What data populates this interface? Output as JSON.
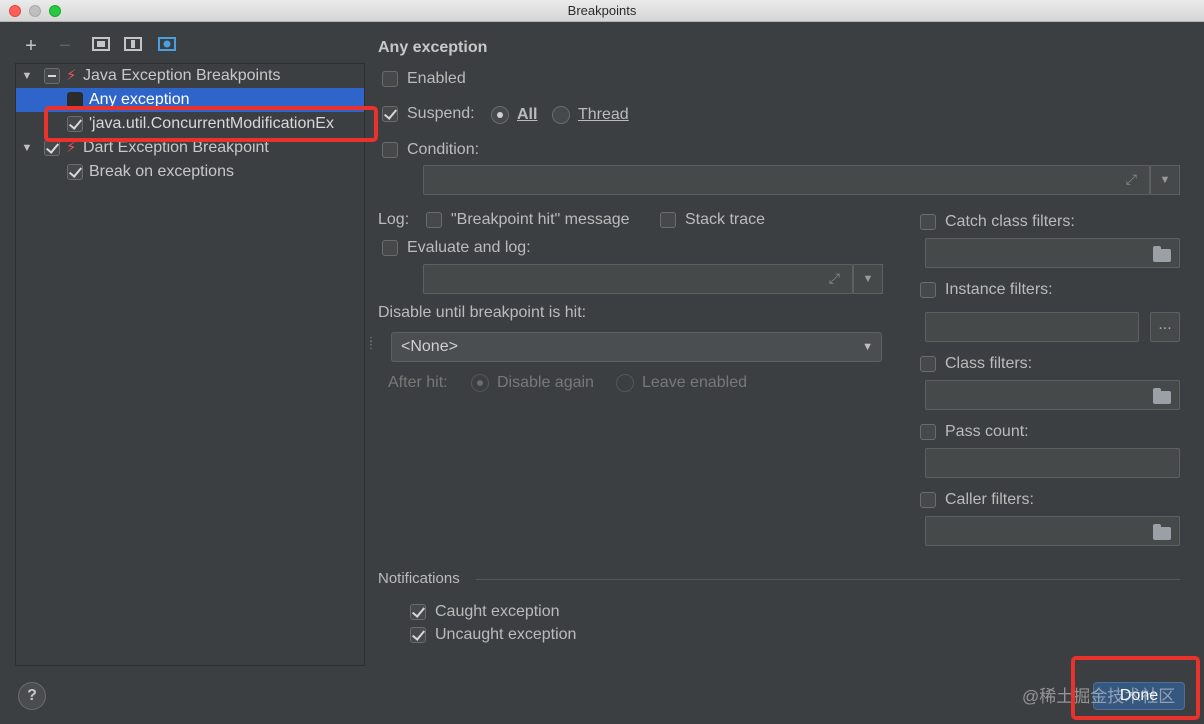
{
  "window": {
    "title": "Breakpoints"
  },
  "toolbar": {
    "add": "+",
    "remove": "−"
  },
  "tree": {
    "group1": {
      "label": "Java Exception Breakpoints"
    },
    "item1": {
      "label": "Any exception"
    },
    "item2": {
      "label": "'java.util.ConcurrentModificationEx"
    },
    "group2": {
      "label": "Dart Exception Breakpoint"
    },
    "item3": {
      "label": "Break on exceptions"
    }
  },
  "detail": {
    "title": "Any exception",
    "enabled": "Enabled",
    "suspend": "Suspend:",
    "suspend_all": "All",
    "suspend_thread": "Thread",
    "condition": "Condition:",
    "log": "Log:",
    "log_message": "\"Breakpoint hit\" message",
    "log_stack": "Stack trace",
    "evaluate": "Evaluate and log:",
    "disable_until": "Disable until breakpoint is hit:",
    "disable_value": "<None>",
    "after_hit": "After hit:",
    "disable_again": "Disable again",
    "leave_enabled": "Leave enabled",
    "catch_filters": "Catch class filters:",
    "instance_filters": "Instance filters:",
    "instance_more": "...",
    "class_filters": "Class filters:",
    "pass_count": "Pass count:",
    "caller_filters": "Caller filters:",
    "notifications": "Notifications",
    "caught": "Caught exception",
    "uncaught": "Uncaught exception"
  },
  "footer": {
    "help": "?",
    "done": "Done",
    "watermark": "@稀土掘金技术社区"
  }
}
